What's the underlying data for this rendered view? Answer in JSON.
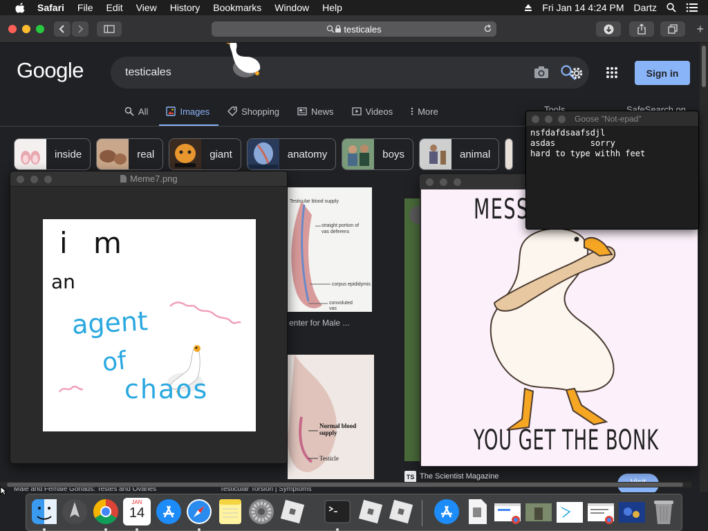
{
  "menubar": {
    "app_name": "Safari",
    "items": [
      "File",
      "Edit",
      "View",
      "History",
      "Bookmarks",
      "Window",
      "Help"
    ],
    "datetime": "Fri Jan 14  4:24 PM",
    "user": "Dartz"
  },
  "browser": {
    "url": "testicales"
  },
  "google": {
    "logo": "Google",
    "query": "testicales",
    "signin_label": "Sign in",
    "tabs": [
      {
        "label": "All",
        "icon": "search-icon"
      },
      {
        "label": "Images",
        "icon": "image-icon",
        "active": true
      },
      {
        "label": "Shopping",
        "icon": "tag-icon"
      },
      {
        "label": "News",
        "icon": "news-icon"
      },
      {
        "label": "Videos",
        "icon": "video-icon"
      },
      {
        "label": "More",
        "icon": "more-icon"
      }
    ],
    "tools_label": "Tools",
    "safesearch_label": "SafeSearch on",
    "chips": [
      "inside",
      "real",
      "giant",
      "anatomy",
      "boys",
      "animal"
    ],
    "results": [
      {
        "caption": "enter for Male ..."
      },
      {
        "caption": "The Scientist Magazine",
        "source_badge": "TS"
      },
      {
        "caption": "Male and Female Gonads: Testes and Ovaries"
      },
      {
        "caption": "Testicular Torsion | Symptoms"
      },
      {
        "caption": "Visit"
      }
    ],
    "anatomy_labels_1": [
      "Testicular blood supply",
      "straight portion of vas deferens",
      "corpus epididymis",
      "convoluted vas"
    ],
    "anatomy_labels_2": [
      "Normal blood supply",
      "Testicle"
    ]
  },
  "preview_window": {
    "title": "Meme7.png",
    "drawing_text": [
      "i m",
      "an",
      "agent",
      "of",
      "chaos"
    ]
  },
  "notepad": {
    "title": "Goose \"Not-epad\"",
    "lines": [
      "nsfdafdsaafsdjl",
      "asdas       sorry",
      "hard to type withh feet"
    ]
  },
  "meme": {
    "top_text": "MESS W",
    "bottom_text": "YOU GET THE BONK"
  },
  "dock": {
    "apps": [
      "finder-icon",
      "launchpad-icon",
      "chrome-icon",
      "calendar-icon",
      "app-store-icon",
      "safari-icon",
      "notes-icon",
      "system-preferences-icon",
      "roblox-icon",
      "terminal-icon",
      "roblox-icon",
      "roblox-icon",
      "app-store-icon",
      "document-icon",
      "window-thumbnail",
      "window-thumbnail",
      "window-thumbnail",
      "window-thumbnail",
      "window-thumbnail",
      "trash-icon"
    ],
    "calendar_month": "JAN",
    "calendar_day": "14"
  },
  "colors": {
    "google_bg": "#202124",
    "accent_blue": "#8ab4f8",
    "goose_orange": "#f5a623"
  }
}
